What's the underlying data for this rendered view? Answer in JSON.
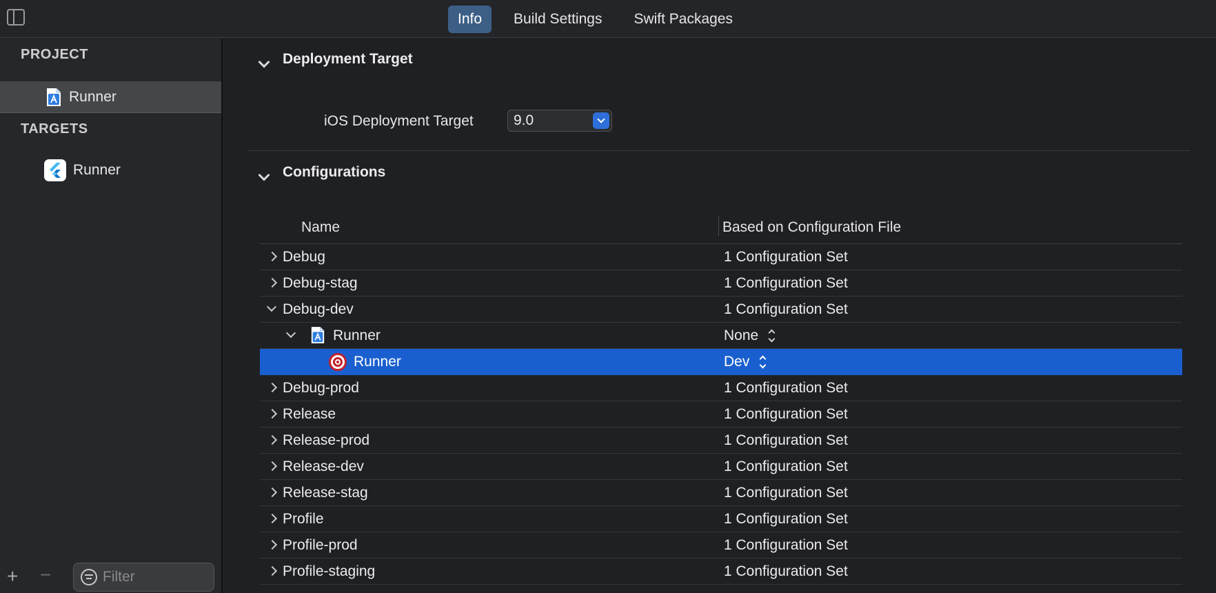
{
  "topbar": {
    "tabs": [
      {
        "label": "Info",
        "active": true
      },
      {
        "label": "Build Settings",
        "active": false
      },
      {
        "label": "Swift Packages",
        "active": false
      }
    ]
  },
  "sidebar": {
    "project_header": "PROJECT",
    "project_item": "Runner",
    "targets_header": "TARGETS",
    "target_item": "Runner",
    "filter_placeholder": "Filter"
  },
  "deployment": {
    "title": "Deployment Target",
    "label": "iOS Deployment Target",
    "value": "9.0"
  },
  "configurations": {
    "title": "Configurations",
    "columns": {
      "name": "Name",
      "based_on": "Based on Configuration File"
    },
    "rows": [
      {
        "name": "Debug",
        "based_on": "1 Configuration Set"
      },
      {
        "name": "Debug-stag",
        "based_on": "1 Configuration Set"
      },
      {
        "name": "Debug-dev",
        "based_on": "1 Configuration Set"
      },
      {
        "name": "Runner",
        "based_on": "None"
      },
      {
        "name": "Runner",
        "based_on": "Dev"
      },
      {
        "name": "Debug-prod",
        "based_on": "1 Configuration Set"
      },
      {
        "name": "Release",
        "based_on": "1 Configuration Set"
      },
      {
        "name": "Release-prod",
        "based_on": "1 Configuration Set"
      },
      {
        "name": "Release-dev",
        "based_on": "1 Configuration Set"
      },
      {
        "name": "Release-stag",
        "based_on": "1 Configuration Set"
      },
      {
        "name": "Profile",
        "based_on": "1 Configuration Set"
      },
      {
        "name": "Profile-prod",
        "based_on": "1 Configuration Set"
      },
      {
        "name": "Profile-staging",
        "based_on": "1 Configuration Set"
      }
    ]
  },
  "colors": {
    "accent": "#1a5fcf",
    "tab_active": "#3d5f86",
    "background": "#1f2023",
    "sidebar": "#26272a"
  }
}
